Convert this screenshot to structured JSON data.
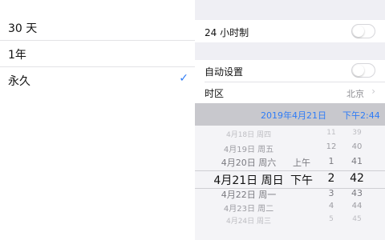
{
  "left_panel": {
    "options": [
      {
        "label": "30 天",
        "selected": false
      },
      {
        "label": "1年",
        "selected": false
      },
      {
        "label": "永久",
        "selected": true
      }
    ],
    "check_glyph": "✓"
  },
  "right_panel": {
    "hour24": {
      "label": "24 小时制",
      "on": false
    },
    "auto_set": {
      "label": "自动设置",
      "on": false
    },
    "timezone": {
      "label": "时区",
      "value": "北京"
    },
    "date_display": {
      "date": "2019年4月21日",
      "time": "下午2:44"
    },
    "picker": {
      "rows": [
        {
          "date": "4月18日 周四",
          "ampm": "",
          "hour": "11",
          "minute": "39"
        },
        {
          "date": "4月19日 周五",
          "ampm": "",
          "hour": "12",
          "minute": "40"
        },
        {
          "date": "4月20日 周六",
          "ampm": "上午",
          "hour": "1",
          "minute": "41"
        },
        {
          "date": "4月21日 周日",
          "ampm": "下午",
          "hour": "2",
          "minute": "42"
        },
        {
          "date": "4月22日 周一",
          "ampm": "",
          "hour": "3",
          "minute": "43"
        },
        {
          "date": "4月23日 周二",
          "ampm": "",
          "hour": "4",
          "minute": "44"
        },
        {
          "date": "4月24日 周三",
          "ampm": "",
          "hour": "5",
          "minute": "45"
        }
      ],
      "selected_index": 3
    }
  },
  "colors": {
    "accent": "#2f7cf6",
    "grouped_bg": "#efeff4",
    "secondary_text": "#8e8e93"
  },
  "icons": {
    "check": "checkmark-icon",
    "chevron": "chevron-right-icon"
  }
}
